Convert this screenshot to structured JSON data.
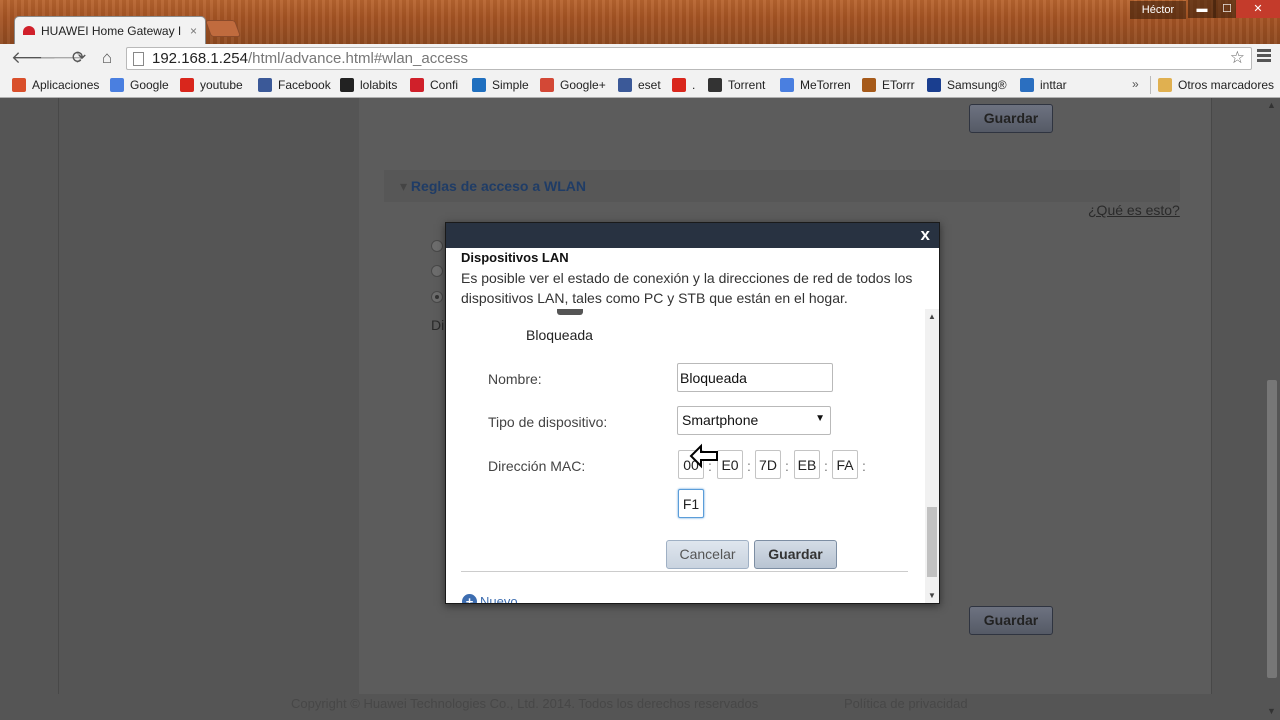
{
  "browser": {
    "tab_title": "HUAWEI Home Gateway I",
    "tab_close": "×",
    "user": "Héctor",
    "url_host": "192.168.1.254",
    "url_path": "/html/advance.html#wlan_access"
  },
  "bookmarks": [
    {
      "label": "Aplicaciones",
      "icon": "apps-grid-icon",
      "color": "#d94f2b"
    },
    {
      "label": "Google",
      "icon": "google-icon",
      "color": "#4a7fe0"
    },
    {
      "label": "youtube",
      "icon": "youtube-icon",
      "color": "#d9261c"
    },
    {
      "label": "Facebook",
      "icon": "facebook-icon",
      "color": "#3b5998"
    },
    {
      "label": "lolabits",
      "icon": "lolabits-icon",
      "color": "#222222"
    },
    {
      "label": "Confi",
      "icon": "huawei-icon",
      "color": "#d0202a"
    },
    {
      "label": "Simple",
      "icon": "simple-icon",
      "color": "#1f6fbf"
    },
    {
      "label": "Google+",
      "icon": "googleplus-icon",
      "color": "#d34836"
    },
    {
      "label": "eset",
      "icon": "facebook-icon",
      "color": "#3b5998"
    },
    {
      "label": ".",
      "icon": "youtube-icon",
      "color": "#d9261c"
    },
    {
      "label": "Torrent",
      "icon": "torrent-icon",
      "color": "#333333"
    },
    {
      "label": "MeTorren",
      "icon": "google-icon",
      "color": "#4a7fe0"
    },
    {
      "label": "ETorrr",
      "icon": "etorrent-icon",
      "color": "#a65a1a"
    },
    {
      "label": "Samsung®",
      "icon": "samsung-icon",
      "color": "#1a3e8f"
    },
    {
      "label": "inttar",
      "icon": "diamond-icon",
      "color": "#2b6fc0"
    }
  ],
  "bookmarks_more": "»",
  "bookmarks_other": "Otros marcadores",
  "page": {
    "save_label": "Guardar",
    "section_title": "Reglas de acceso a WLAN",
    "help_link": "¿Qué es esto?",
    "dim_text": "Di",
    "footer_copyright": "Copyright © Huawei Technologies Co., Ltd. 2014. Todos los derechos reservados",
    "footer_privacy": "Política de privacidad"
  },
  "modal": {
    "close": "x",
    "title": "Dispositivos LAN",
    "description": "Es posible ver el estado de conexión y la direcciones de red de todos los dispositivos LAN, tales como PC y STB que están en el hogar.",
    "device_name": "Bloqueada",
    "fields": {
      "name_label": "Nombre:",
      "name_value": "Bloqueada",
      "type_label": "Tipo de dispositivo:",
      "type_value": "Smartphone",
      "mac_label": "Dirección MAC:",
      "mac": [
        "00",
        "E0",
        "7D",
        "EB",
        "FA",
        "F1"
      ],
      "mac_separator": ":"
    },
    "cancel_label": "Cancelar",
    "save_label": "Guardar",
    "new_label": "Nuevo"
  }
}
